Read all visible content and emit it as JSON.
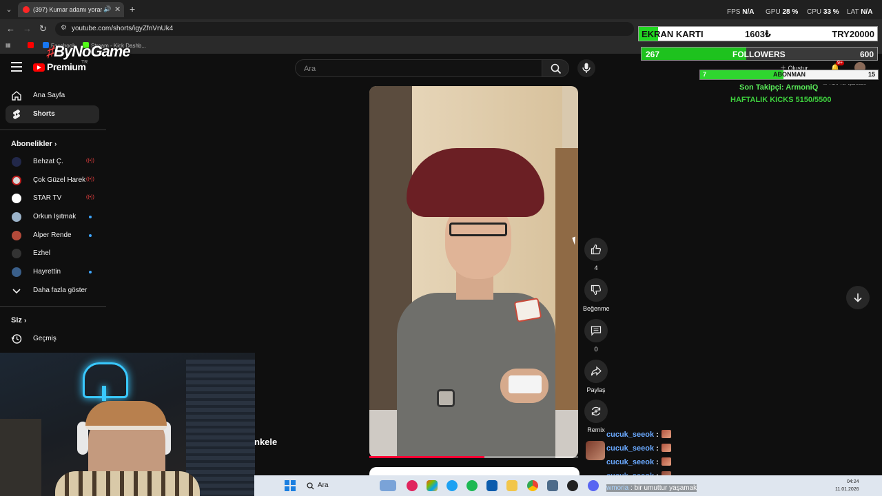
{
  "browser": {
    "tab_title": "(397) Kumar adamı yorar #",
    "url": "youtube.com/shorts/igyZfnVnUk4",
    "bookmarks": [
      "Facebook",
      "Stream - Kick Dashb..."
    ],
    "all_bookmarks": "Tüm Yer İşaretleri",
    "stats": {
      "fps_label": "FPS",
      "fps_value": "N/A",
      "gpu_label": "GPU",
      "gpu_value": "28 %",
      "cpu_label": "CPU",
      "cpu_value": "33 %",
      "lat_label": "LAT",
      "lat_value": "N/A"
    }
  },
  "youtube": {
    "logo": "Premium",
    "logo_region": "TR",
    "search_placeholder": "Ara",
    "create_label": "Oluştur",
    "notification_badge": "9+",
    "sidebar": {
      "home": "Ana Sayfa",
      "shorts": "Shorts",
      "subscriptions_heading": "Abonelikler",
      "subscriptions": [
        {
          "name": "Behzat Ç.",
          "status": "live"
        },
        {
          "name": "Çok Güzel Hareket...",
          "status": "live"
        },
        {
          "name": "STAR TV",
          "status": "live"
        },
        {
          "name": "Orkun Işıtmak",
          "status": "new"
        },
        {
          "name": "Alper Rende",
          "status": "new"
        },
        {
          "name": "Ezhel",
          "status": ""
        },
        {
          "name": "Hayrettin",
          "status": "new"
        }
      ],
      "show_more": "Daha fazla göster",
      "you_heading": "Siz",
      "history": "Geçmiş"
    },
    "actions": {
      "like_count": "4",
      "dislike_label": "Beğenme",
      "comment_count": "0",
      "share_label": "Paylaş",
      "remix_label": "Remix"
    },
    "video_progress": 0.55
  },
  "overlay": {
    "brand": "ByNoGame",
    "ekran_karti": {
      "label": "EKRAN KARTI",
      "current": "1603₺",
      "goal": "TRY20000",
      "progress": 0.08
    },
    "followers": {
      "current": "267",
      "label": "FOLLOWERS",
      "goal": "600",
      "progress": 0.445
    },
    "abonman": {
      "current": "7",
      "label": "ABONMAN",
      "goal": "15",
      "progress": 0.47
    },
    "last_follower": "Son Takipçi: ArmoniQ",
    "weekly_kicks": "HAFTALIK KICKS 5150/5500",
    "cam_caption": "nkele"
  },
  "chat": {
    "messages": [
      {
        "user": "cucuk_seeok",
        "sep": ":"
      },
      {
        "user": "cucuk_seeok",
        "sep": ":"
      },
      {
        "user": "cucuk_seeok",
        "sep": ":"
      },
      {
        "user": "cucuk_seeok",
        "sep": ":"
      }
    ],
    "highlight": {
      "user": "wmoria",
      "sep": ":",
      "text": "bir umuttur yaşamak"
    }
  },
  "taskbar": {
    "search": "Ara",
    "time": "04:24",
    "date": "11.01.2026"
  },
  "colors": {
    "youtube_red": "#ff0000",
    "overlay_green": "#22d722",
    "link_blue": "#6aa9ff"
  }
}
